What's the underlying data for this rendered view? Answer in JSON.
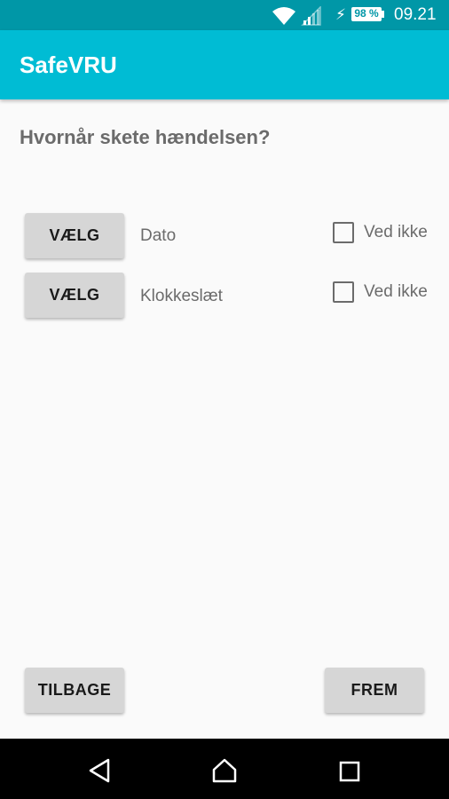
{
  "status_bar": {
    "battery": "98 %",
    "time": "09.21"
  },
  "app_bar": {
    "title": "SafeVRU"
  },
  "main": {
    "question": "Hvornår skete hændelsen?",
    "rows": [
      {
        "button_label": "VÆLG",
        "label": "Dato",
        "checkbox_label": "Ved ikke",
        "checked": false
      },
      {
        "button_label": "VÆLG",
        "label": "Klokkeslæt",
        "checkbox_label": "Ved ikke",
        "checked": false
      }
    ]
  },
  "footer": {
    "back_label": "TILBAGE",
    "next_label": "FREM"
  },
  "nav_bar": {
    "icons": [
      "back-icon",
      "home-icon",
      "recents-icon"
    ]
  },
  "colors": {
    "status_bar": "#0097a7",
    "app_bar": "#00bcd4",
    "background": "#fafafa",
    "button": "#d6d6d6"
  }
}
